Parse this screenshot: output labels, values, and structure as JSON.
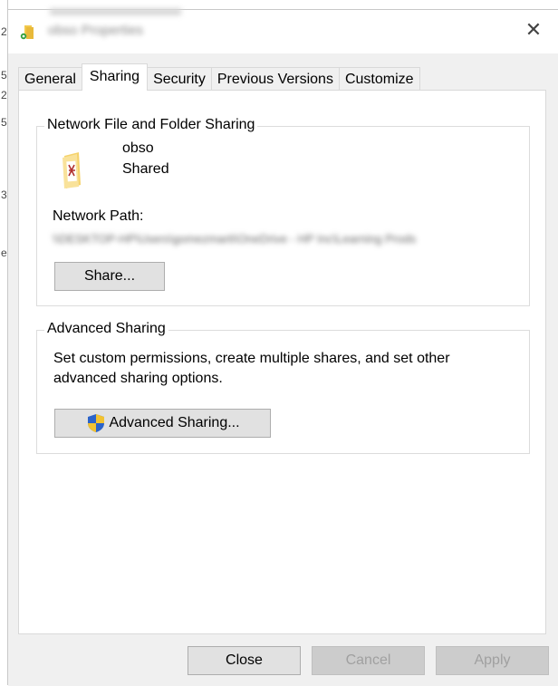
{
  "background_window": {
    "edge_glyphs": [
      "2",
      "5",
      "2",
      "5",
      "3",
      "e"
    ]
  },
  "titlebar": {
    "title": "obso Properties",
    "close_glyph": "✕"
  },
  "tabs": [
    {
      "label": "General",
      "active": false
    },
    {
      "label": "Sharing",
      "active": true
    },
    {
      "label": "Security",
      "active": false
    },
    {
      "label": "Previous Versions",
      "active": false
    },
    {
      "label": "Customize",
      "active": false
    }
  ],
  "network_sharing": {
    "group_title": "Network File and Folder Sharing",
    "folder_name": "obso",
    "status": "Shared",
    "network_path_label": "Network Path:",
    "network_path_value": "\\\\DESKTOP-HP\\Users\\gomezmarti\\OneDrive - HP Inc\\Learning Prods",
    "share_button": "Share..."
  },
  "advanced_sharing": {
    "group_title": "Advanced Sharing",
    "description": "Set custom permissions, create multiple shares, and set other advanced sharing options.",
    "button": "Advanced Sharing..."
  },
  "footer": {
    "close": "Close",
    "cancel": "Cancel",
    "apply": "Apply"
  },
  "colors": {
    "dialog_bg": "#f0f0f0",
    "panel_bg": "#ffffff",
    "button_bg": "#e1e1e1",
    "disabled_text": "#a0a0a0"
  }
}
